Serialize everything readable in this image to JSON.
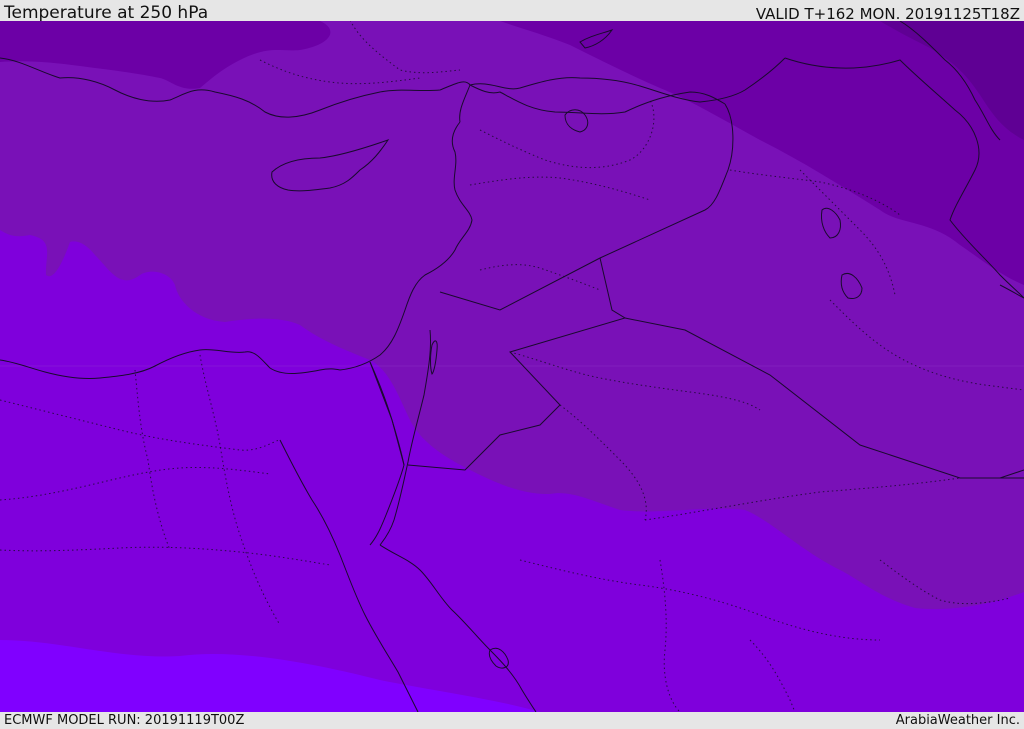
{
  "header": {
    "title": "Temperature at 250 hPa",
    "valid": "VALID T+162 MON. 20191125T18Z"
  },
  "footer": {
    "model_run": "ECMWF MODEL RUN: 20191119T00Z",
    "credit": "ArabiaWeather Inc."
  },
  "map": {
    "field": "temperature_250hPa",
    "colors": {
      "darkest": "#5f0094",
      "dark": "#6c00a6",
      "mid": "#7911b7",
      "light": "#7f00dc",
      "lightest": "#8000ff",
      "lines": "#1a0a2e"
    }
  }
}
